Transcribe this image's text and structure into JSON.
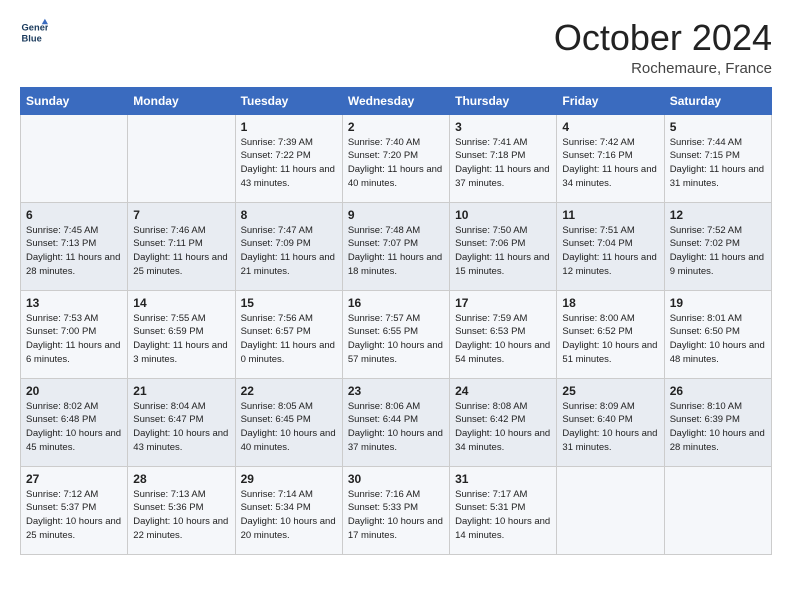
{
  "header": {
    "logo_line1": "General",
    "logo_line2": "Blue",
    "month": "October 2024",
    "location": "Rochemaure, France"
  },
  "days_of_week": [
    "Sunday",
    "Monday",
    "Tuesday",
    "Wednesday",
    "Thursday",
    "Friday",
    "Saturday"
  ],
  "weeks": [
    [
      {
        "day": "",
        "sunrise": "",
        "sunset": "",
        "daylight": ""
      },
      {
        "day": "",
        "sunrise": "",
        "sunset": "",
        "daylight": ""
      },
      {
        "day": "1",
        "sunrise": "Sunrise: 7:39 AM",
        "sunset": "Sunset: 7:22 PM",
        "daylight": "Daylight: 11 hours and 43 minutes."
      },
      {
        "day": "2",
        "sunrise": "Sunrise: 7:40 AM",
        "sunset": "Sunset: 7:20 PM",
        "daylight": "Daylight: 11 hours and 40 minutes."
      },
      {
        "day": "3",
        "sunrise": "Sunrise: 7:41 AM",
        "sunset": "Sunset: 7:18 PM",
        "daylight": "Daylight: 11 hours and 37 minutes."
      },
      {
        "day": "4",
        "sunrise": "Sunrise: 7:42 AM",
        "sunset": "Sunset: 7:16 PM",
        "daylight": "Daylight: 11 hours and 34 minutes."
      },
      {
        "day": "5",
        "sunrise": "Sunrise: 7:44 AM",
        "sunset": "Sunset: 7:15 PM",
        "daylight": "Daylight: 11 hours and 31 minutes."
      }
    ],
    [
      {
        "day": "6",
        "sunrise": "Sunrise: 7:45 AM",
        "sunset": "Sunset: 7:13 PM",
        "daylight": "Daylight: 11 hours and 28 minutes."
      },
      {
        "day": "7",
        "sunrise": "Sunrise: 7:46 AM",
        "sunset": "Sunset: 7:11 PM",
        "daylight": "Daylight: 11 hours and 25 minutes."
      },
      {
        "day": "8",
        "sunrise": "Sunrise: 7:47 AM",
        "sunset": "Sunset: 7:09 PM",
        "daylight": "Daylight: 11 hours and 21 minutes."
      },
      {
        "day": "9",
        "sunrise": "Sunrise: 7:48 AM",
        "sunset": "Sunset: 7:07 PM",
        "daylight": "Daylight: 11 hours and 18 minutes."
      },
      {
        "day": "10",
        "sunrise": "Sunrise: 7:50 AM",
        "sunset": "Sunset: 7:06 PM",
        "daylight": "Daylight: 11 hours and 15 minutes."
      },
      {
        "day": "11",
        "sunrise": "Sunrise: 7:51 AM",
        "sunset": "Sunset: 7:04 PM",
        "daylight": "Daylight: 11 hours and 12 minutes."
      },
      {
        "day": "12",
        "sunrise": "Sunrise: 7:52 AM",
        "sunset": "Sunset: 7:02 PM",
        "daylight": "Daylight: 11 hours and 9 minutes."
      }
    ],
    [
      {
        "day": "13",
        "sunrise": "Sunrise: 7:53 AM",
        "sunset": "Sunset: 7:00 PM",
        "daylight": "Daylight: 11 hours and 6 minutes."
      },
      {
        "day": "14",
        "sunrise": "Sunrise: 7:55 AM",
        "sunset": "Sunset: 6:59 PM",
        "daylight": "Daylight: 11 hours and 3 minutes."
      },
      {
        "day": "15",
        "sunrise": "Sunrise: 7:56 AM",
        "sunset": "Sunset: 6:57 PM",
        "daylight": "Daylight: 11 hours and 0 minutes."
      },
      {
        "day": "16",
        "sunrise": "Sunrise: 7:57 AM",
        "sunset": "Sunset: 6:55 PM",
        "daylight": "Daylight: 10 hours and 57 minutes."
      },
      {
        "day": "17",
        "sunrise": "Sunrise: 7:59 AM",
        "sunset": "Sunset: 6:53 PM",
        "daylight": "Daylight: 10 hours and 54 minutes."
      },
      {
        "day": "18",
        "sunrise": "Sunrise: 8:00 AM",
        "sunset": "Sunset: 6:52 PM",
        "daylight": "Daylight: 10 hours and 51 minutes."
      },
      {
        "day": "19",
        "sunrise": "Sunrise: 8:01 AM",
        "sunset": "Sunset: 6:50 PM",
        "daylight": "Daylight: 10 hours and 48 minutes."
      }
    ],
    [
      {
        "day": "20",
        "sunrise": "Sunrise: 8:02 AM",
        "sunset": "Sunset: 6:48 PM",
        "daylight": "Daylight: 10 hours and 45 minutes."
      },
      {
        "day": "21",
        "sunrise": "Sunrise: 8:04 AM",
        "sunset": "Sunset: 6:47 PM",
        "daylight": "Daylight: 10 hours and 43 minutes."
      },
      {
        "day": "22",
        "sunrise": "Sunrise: 8:05 AM",
        "sunset": "Sunset: 6:45 PM",
        "daylight": "Daylight: 10 hours and 40 minutes."
      },
      {
        "day": "23",
        "sunrise": "Sunrise: 8:06 AM",
        "sunset": "Sunset: 6:44 PM",
        "daylight": "Daylight: 10 hours and 37 minutes."
      },
      {
        "day": "24",
        "sunrise": "Sunrise: 8:08 AM",
        "sunset": "Sunset: 6:42 PM",
        "daylight": "Daylight: 10 hours and 34 minutes."
      },
      {
        "day": "25",
        "sunrise": "Sunrise: 8:09 AM",
        "sunset": "Sunset: 6:40 PM",
        "daylight": "Daylight: 10 hours and 31 minutes."
      },
      {
        "day": "26",
        "sunrise": "Sunrise: 8:10 AM",
        "sunset": "Sunset: 6:39 PM",
        "daylight": "Daylight: 10 hours and 28 minutes."
      }
    ],
    [
      {
        "day": "27",
        "sunrise": "Sunrise: 7:12 AM",
        "sunset": "Sunset: 5:37 PM",
        "daylight": "Daylight: 10 hours and 25 minutes."
      },
      {
        "day": "28",
        "sunrise": "Sunrise: 7:13 AM",
        "sunset": "Sunset: 5:36 PM",
        "daylight": "Daylight: 10 hours and 22 minutes."
      },
      {
        "day": "29",
        "sunrise": "Sunrise: 7:14 AM",
        "sunset": "Sunset: 5:34 PM",
        "daylight": "Daylight: 10 hours and 20 minutes."
      },
      {
        "day": "30",
        "sunrise": "Sunrise: 7:16 AM",
        "sunset": "Sunset: 5:33 PM",
        "daylight": "Daylight: 10 hours and 17 minutes."
      },
      {
        "day": "31",
        "sunrise": "Sunrise: 7:17 AM",
        "sunset": "Sunset: 5:31 PM",
        "daylight": "Daylight: 10 hours and 14 minutes."
      },
      {
        "day": "",
        "sunrise": "",
        "sunset": "",
        "daylight": ""
      },
      {
        "day": "",
        "sunrise": "",
        "sunset": "",
        "daylight": ""
      }
    ]
  ]
}
